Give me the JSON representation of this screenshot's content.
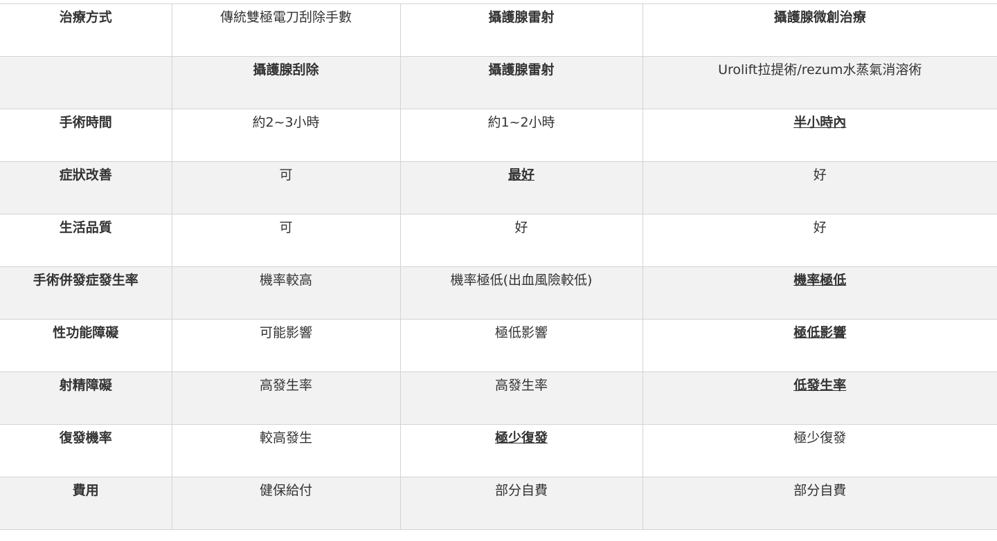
{
  "table": {
    "header": [
      "治療方式",
      "傳統雙極電刀刮除手數",
      "攝護腺雷射",
      "攝護腺微創治療"
    ],
    "header_styles": [
      "bold",
      "normal",
      "bold",
      "bold"
    ],
    "rows": [
      {
        "label": "",
        "cells": [
          "攝護腺刮除",
          "攝護腺雷射",
          "Urolift拉提術/rezum水蒸氣消溶術"
        ],
        "styles": [
          "bold",
          "bold",
          "normal"
        ]
      },
      {
        "label": "手術時間",
        "cells": [
          "約2~3小時",
          "約1~2小時",
          "半小時內"
        ],
        "styles": [
          "normal",
          "normal",
          "bold-underline"
        ]
      },
      {
        "label": "症狀改善",
        "cells": [
          "可",
          "最好",
          "好"
        ],
        "styles": [
          "normal",
          "bold-underline",
          "normal"
        ]
      },
      {
        "label": "生活品質",
        "cells": [
          "可",
          "好",
          "好"
        ],
        "styles": [
          "normal",
          "normal",
          "normal"
        ]
      },
      {
        "label": "手術併發症發生率",
        "cells": [
          "機率較高",
          "機率極低(出血風險較低)",
          "機率極低"
        ],
        "styles": [
          "normal",
          "normal",
          "bold-underline"
        ]
      },
      {
        "label": "性功能障礙",
        "cells": [
          "可能影響",
          "極低影響",
          "極低影響"
        ],
        "styles": [
          "normal",
          "normal",
          "bold-underline"
        ]
      },
      {
        "label": "射精障礙",
        "cells": [
          "高發生率",
          "高發生率",
          "低發生率"
        ],
        "styles": [
          "normal",
          "normal",
          "bold-underline"
        ]
      },
      {
        "label": "復發機率",
        "cells": [
          "較高發生",
          "極少復發",
          "極少復發"
        ],
        "styles": [
          "normal",
          "bold-underline",
          "normal"
        ]
      },
      {
        "label": "費用",
        "cells": [
          "健保給付",
          "部分自費",
          "部分自費"
        ],
        "styles": [
          "normal",
          "normal",
          "normal"
        ]
      }
    ]
  }
}
